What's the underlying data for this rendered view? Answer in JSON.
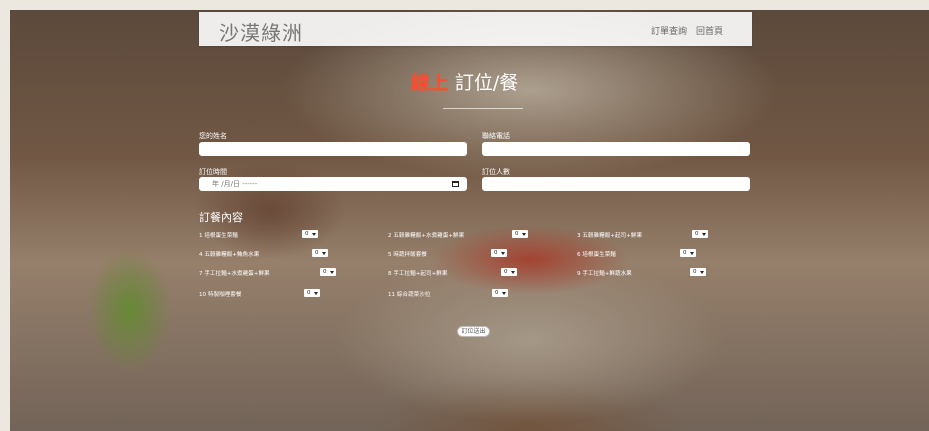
{
  "header": {
    "brand": "沙漠綠洲",
    "nav": [
      "訂單查詢",
      "回首頁"
    ]
  },
  "hero": {
    "title_accent": "線上",
    "title_rest": " 訂位/餐"
  },
  "form": {
    "name_label": "您的姓名",
    "phone_label": "聯絡電話",
    "date_label": "訂位時間",
    "date_placeholder": "年 /月/日 ------",
    "people_label": "訂位人數"
  },
  "order": {
    "title": "訂餐內容",
    "items": [
      {
        "label": "1 培根蛋生菜麵",
        "qty": "0"
      },
      {
        "label": "2 五穀雜糧飯+水煮雞蛋+鮮果",
        "qty": "0"
      },
      {
        "label": "3 五穀雜糧飯+起司+鮮果",
        "qty": "0"
      },
      {
        "label": "4 五穀雜糧飯+鮪魚水果",
        "qty": "0"
      },
      {
        "label": "5 時蔬拌飯套餐",
        "qty": "0"
      },
      {
        "label": "6 培根蛋生菜麵",
        "qty": "0"
      },
      {
        "label": "7 手工拉麵+水煮雞蛋+鮮果",
        "qty": "0"
      },
      {
        "label": "8 手工拉麵+起司+鮮果",
        "qty": "0"
      },
      {
        "label": "9 手工拉麵+鮮蔬水果",
        "qty": "0"
      },
      {
        "label": "10 特製咖哩套餐",
        "qty": "0"
      },
      {
        "label": "11 綜合蔬菜沙拉",
        "qty": "0"
      }
    ]
  },
  "submit_label": "訂位送出"
}
